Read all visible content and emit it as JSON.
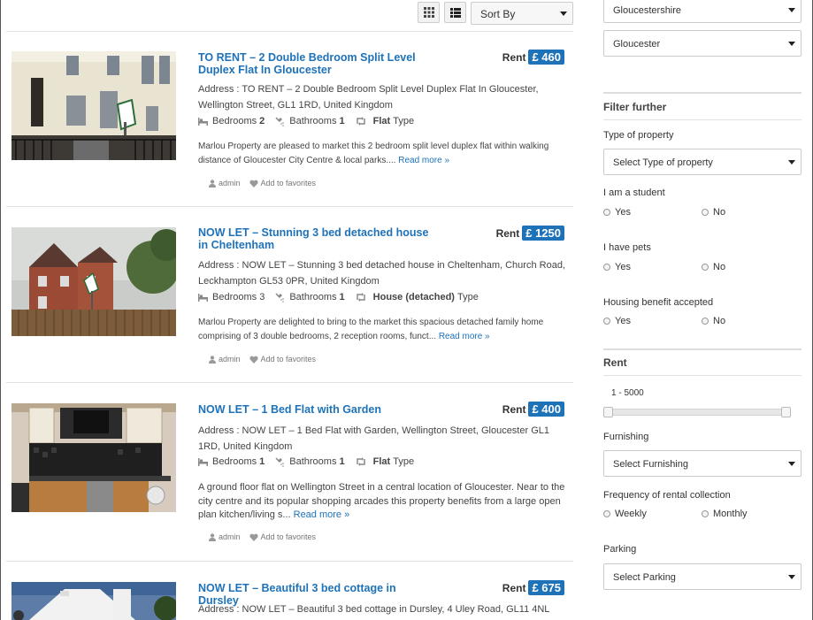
{
  "toolbar": {
    "grid_view_icon": "grid-icon",
    "list_view_icon": "list-icon",
    "sort_value": "Sort By"
  },
  "listings": [
    {
      "title": "TO RENT – 2 Double Bedroom Split Level Duplex Flat In Gloucester",
      "rent_label": "Rent",
      "price": "£ 460",
      "address": "Address : TO RENT – 2 Double Bedroom Split Level Duplex Flat In Gloucester, Wellington Street, GL1 1RD, United Kingdom",
      "bedrooms_label": "Bedrooms",
      "bedrooms": "2",
      "bathrooms_label": "Bathrooms",
      "bathrooms": "1",
      "type_value": "Flat",
      "type_label": "Type",
      "description": "Marlou Property are pleased to market this 2 bedroom split level duplex flat within walking distance of Gloucester City Centre & local parks....",
      "read_more": "Read more »",
      "author": "admin",
      "favorites": "Add to favorites"
    },
    {
      "title": "NOW LET – Stunning 3 bed detached house in Cheltenham",
      "rent_label": "Rent",
      "price": "£ 1250",
      "address": "Address : NOW LET – Stunning 3 bed detached house in Cheltenham, Church Road, Leckhampton GL53 0PR, United Kingdom",
      "bedrooms_label": "Bedrooms",
      "bedrooms": "3",
      "bathrooms_label": "Bathrooms",
      "bathrooms": "1",
      "type_value": "House (detached)",
      "type_label": "Type",
      "description": "Marlou Property are delighted to bring to the market this spacious detached family home comprising of 3 double bedrooms, 2 reception rooms, funct...",
      "read_more": "Read more »",
      "author": "admin",
      "favorites": "Add to favorites"
    },
    {
      "title": "NOW LET – 1 Bed Flat with Garden",
      "rent_label": "Rent",
      "price": "£ 400",
      "address": "Address : NOW LET – 1 Bed Flat with Garden, Wellington Street, Gloucester GL1 1RD, United Kingdom",
      "bedrooms_label": "Bedrooms",
      "bedrooms": "1",
      "bathrooms_label": "Bathrooms",
      "bathrooms": "1",
      "type_value": "Flat",
      "type_label": "Type",
      "description": "A ground floor flat on Wellington Street in a central location of Gloucester. Near to the city centre and its popular shopping arcades this property benefits from a large open plan kitchen/living s...",
      "read_more": "Read more »",
      "author": "admin",
      "favorites": "Add to favorites"
    },
    {
      "title": "NOW LET – Beautiful 3 bed cottage in Dursley",
      "rent_label": "Rent",
      "price": "£ 675",
      "address": "Address : NOW LET – Beautiful 3 bed cottage in Dursley, 4 Uley Road, GL11 4NL"
    }
  ],
  "sidebar": {
    "county_value": "Gloucestershire",
    "city_value": "Gloucester",
    "filter_heading": "Filter further",
    "type_label": "Type of property",
    "type_placeholder": "Select Type of property",
    "student_label": "I am a student",
    "pets_label": "I have pets",
    "benefit_label": "Housing benefit accepted",
    "yes": "Yes",
    "no": "No",
    "rent_heading": "Rent",
    "rent_range": "1 - 5000",
    "rent_min_fraction": 0,
    "rent_max_fraction": 1,
    "furnishing_label": "Furnishing",
    "furnishing_placeholder": "Select Furnishing",
    "frequency_label": "Frequency of rental collection",
    "weekly": "Weekly",
    "monthly": "Monthly",
    "parking_label": "Parking",
    "parking_placeholder": "Select Parking"
  },
  "colors": {
    "accent": "#1e72b8"
  }
}
